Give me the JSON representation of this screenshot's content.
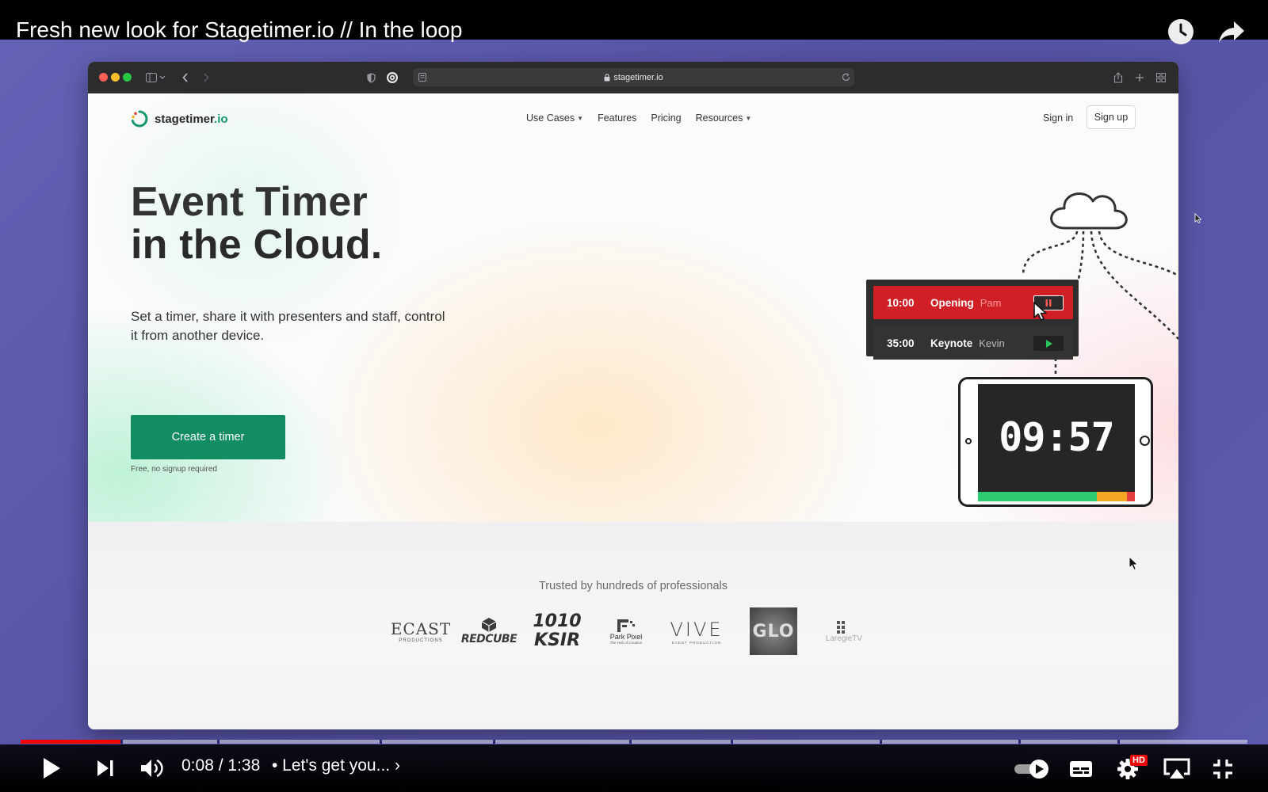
{
  "player": {
    "video_title": "Fresh new look for Stagetimer.io // In the loop",
    "time_current": "0:08",
    "time_separator": " / ",
    "time_total": "1:38",
    "chapter": "• Let's get you... ›",
    "progress_fraction": 0.082,
    "accent_color": "#ff0000",
    "hd_badge": "HD"
  },
  "browser": {
    "url": "stagetimer.io"
  },
  "site": {
    "logo_name": "stagetimer",
    "logo_tld": ".io",
    "nav": {
      "use_cases": "Use Cases",
      "features": "Features",
      "pricing": "Pricing",
      "resources": "Resources"
    },
    "sign_in": "Sign in",
    "sign_up": "Sign up",
    "headline_line1": "Event Timer",
    "headline_line2": "in the Cloud.",
    "subheadline": "Set a timer, share it with presenters and staff, control it from another device.",
    "cta_label": "Create a timer",
    "cta_note": "Free, no signup required",
    "brand_color": "#128c62",
    "timers": [
      {
        "time": "10:00",
        "name": "Opening",
        "presenter": "Pam",
        "state": "running"
      },
      {
        "time": "35:00",
        "name": "Keynote",
        "presenter": "Kevin",
        "state": "paused"
      }
    ],
    "tablet_clock": "09:57",
    "trusted_heading": "Trusted by hundreds of professionals",
    "client_logos": {
      "ecast": "ECAST",
      "ecast_sub": "PRODUCTIONS",
      "redcube": "REDCUBE",
      "ksir_1": "1010",
      "ksir_2": "KSIR",
      "parkpixel": "Park Pixel",
      "parkpixel_sub": "The Hub of Creation",
      "vive": "VIVE",
      "vive_sub": "EVENT PRODUCTION",
      "glo": "GLO",
      "laregie": "LaregieTV"
    }
  }
}
